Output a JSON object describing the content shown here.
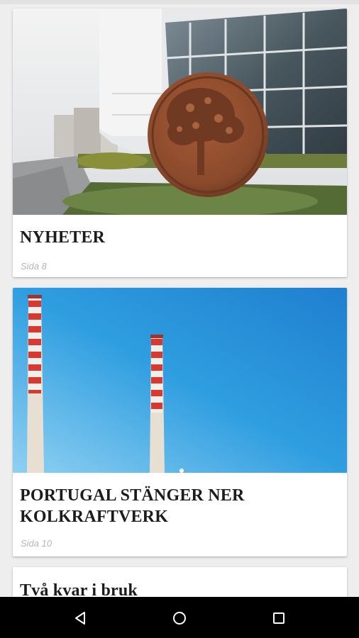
{
  "articles": [
    {
      "title": "NYHETER",
      "page": "Sida 8"
    },
    {
      "title": "PORTUGAL STÄNGER NER KOLKRAFTVERK",
      "page": "Sida 10"
    },
    {
      "title": "Två kvar i bruk"
    }
  ],
  "nav": {
    "back_icon": "back-icon",
    "home_icon": "home-icon",
    "recents_icon": "recents-icon"
  },
  "colors": {
    "sky": "#2f9ee0",
    "chimney_red": "#d8382f",
    "nav_background": "#000000",
    "plaque": "#8a4a2c"
  }
}
